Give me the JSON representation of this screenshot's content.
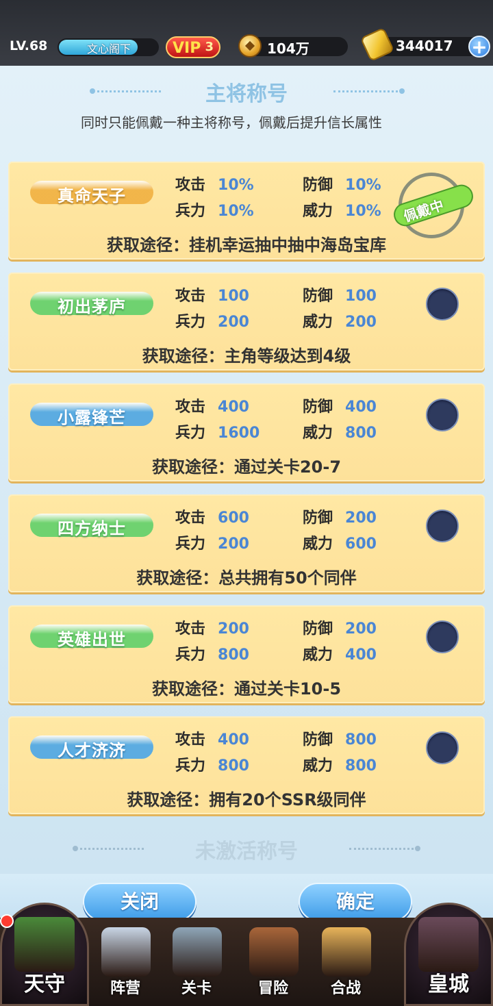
{
  "topbar": {
    "level": "LV.68",
    "player_name": "文心阁下",
    "exp_fraction": 0.8,
    "vip_label": "VIP",
    "vip_level": "3",
    "coins": "104万",
    "gold": "344017",
    "add_label": "+"
  },
  "panel": {
    "title": "主将称号",
    "subtitle": "同时只能佩戴一种主将称号，佩戴后提升信长属性",
    "inactive_title": "未激活称号",
    "route_prefix": "获取途径："
  },
  "titles": [
    {
      "name": "真命天子",
      "attack_label": "攻击",
      "attack": "10%",
      "defense_label": "防御",
      "defense": "10%",
      "troops_label": "兵力",
      "troops": "10%",
      "power_label": "威力",
      "power": "10%",
      "route": "获取途径：挂机幸运抽中抽中海岛宝库",
      "equipped": true,
      "equipped_label": "佩戴中",
      "color": "#f0b040"
    },
    {
      "name": "初出茅庐",
      "attack_label": "攻击",
      "attack": "100",
      "defense_label": "防御",
      "defense": "100",
      "troops_label": "兵力",
      "troops": "200",
      "power_label": "威力",
      "power": "200",
      "route": "获取途径：主角等级达到4级",
      "equipped": false,
      "color": "#5fd06a"
    },
    {
      "name": "小露锋芒",
      "attack_label": "攻击",
      "attack": "400",
      "defense_label": "防御",
      "defense": "400",
      "troops_label": "兵力",
      "troops": "1600",
      "power_label": "威力",
      "power": "800",
      "route": "获取途径：通过关卡20-7",
      "equipped": false,
      "color": "#4aa6e8"
    },
    {
      "name": "四方纳士",
      "attack_label": "攻击",
      "attack": "600",
      "defense_label": "防御",
      "defense": "200",
      "troops_label": "兵力",
      "troops": "200",
      "power_label": "威力",
      "power": "600",
      "route": "获取途径：总共拥有50个同伴",
      "equipped": false,
      "color": "#5fd06a"
    },
    {
      "name": "英雄出世",
      "attack_label": "攻击",
      "attack": "200",
      "defense_label": "防御",
      "defense": "200",
      "troops_label": "兵力",
      "troops": "800",
      "power_label": "威力",
      "power": "400",
      "route": "获取途径：通过关卡10-5",
      "equipped": false,
      "color": "#5fd06a"
    },
    {
      "name": "人才济济",
      "attack_label": "攻击",
      "attack": "400",
      "defense_label": "防御",
      "defense": "800",
      "troops_label": "兵力",
      "troops": "800",
      "power_label": "威力",
      "power": "800",
      "route": "获取途径：拥有20个SSR级同伴",
      "equipped": false,
      "color": "#4aa6e8"
    }
  ],
  "buttons": {
    "close": "关闭",
    "confirm": "确定"
  },
  "nav": [
    {
      "label": "天守",
      "icon": "castle-icon"
    },
    {
      "label": "阵营",
      "icon": "scroll-icon"
    },
    {
      "label": "关卡",
      "icon": "crossed-swords-icon"
    },
    {
      "label": "冒险",
      "icon": "ship-icon"
    },
    {
      "label": "合战",
      "icon": "banner-icon"
    },
    {
      "label": "皇城",
      "icon": "palace-icon"
    }
  ]
}
